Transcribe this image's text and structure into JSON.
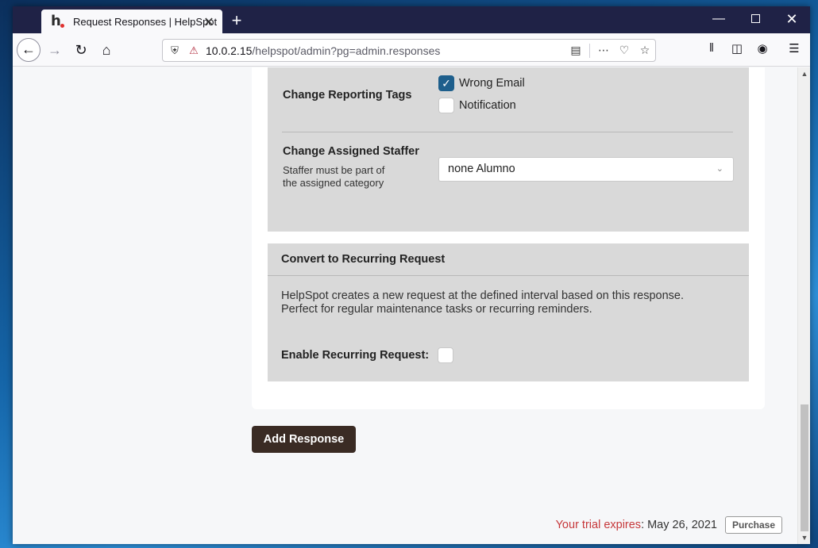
{
  "browser": {
    "tab_title": "Request Responses | HelpSpot",
    "favicon_letter": "h.",
    "url_host": "10.0.2.15",
    "url_path": "/helpspot/admin?pg=admin.responses",
    "new_tab_glyph": "+",
    "close_glyph": "✕"
  },
  "reporting_tags": {
    "label": "Change Reporting Tags",
    "options": [
      {
        "label": "Wrong Email",
        "checked": true
      },
      {
        "label": "Notification",
        "checked": false
      }
    ]
  },
  "assigned_staffer": {
    "label": "Change Assigned Staffer",
    "help_line1": "Staffer must be part of",
    "help_line2": "the assigned category",
    "selected": "none Alumno"
  },
  "recurring": {
    "title": "Convert to Recurring Request",
    "description_line1": "HelpSpot creates a new request at the defined interval based on this response.",
    "description_line2": "Perfect for regular maintenance tasks or recurring reminders.",
    "enable_label": "Enable Recurring Request:",
    "enabled": false
  },
  "actions": {
    "add_response_label": "Add Response"
  },
  "trial": {
    "label": "Your trial expires",
    "colon": ":",
    "date": "May 26, 2021",
    "purchase_label": "Purchase"
  },
  "colors": {
    "primary_button": "#3a2b24",
    "checkbox_checked": "#1e5f8c",
    "trial_red": "#c6373a",
    "panel_bg": "#d9d9d9"
  },
  "icons": [
    "back-icon",
    "forward-icon",
    "reload-icon",
    "home-icon",
    "shield-icon",
    "insecure-lock-icon",
    "reader-view-icon",
    "more-icon",
    "pocket-icon",
    "bookmark-star-icon",
    "library-icon",
    "sidebar-icon",
    "account-icon",
    "menu-icon"
  ]
}
